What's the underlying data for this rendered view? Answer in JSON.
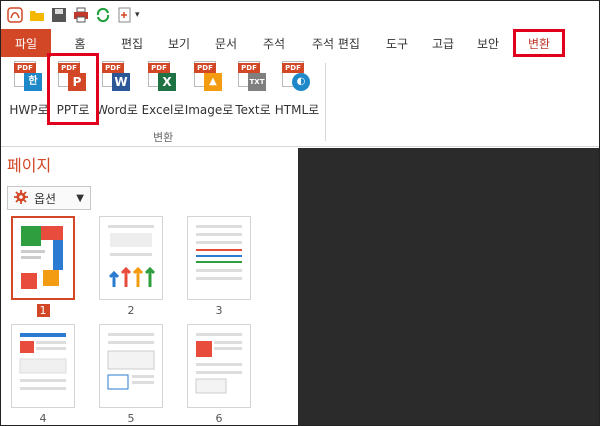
{
  "quick_access": {
    "icons": [
      "pdf-app-icon",
      "open-folder-icon",
      "save-icon",
      "print-icon",
      "refresh-icon",
      "add-page-icon"
    ],
    "dropdown": "▾"
  },
  "tabs": [
    {
      "label": "파일",
      "kind": "file"
    },
    {
      "label": "홈",
      "kind": "normal"
    },
    {
      "label": "편집",
      "kind": "normal"
    },
    {
      "label": "보기",
      "kind": "normal"
    },
    {
      "label": "문서",
      "kind": "normal"
    },
    {
      "label": "주석",
      "kind": "normal"
    },
    {
      "label": "주석 편집",
      "kind": "normal"
    },
    {
      "label": "도구",
      "kind": "normal"
    },
    {
      "label": "고급",
      "kind": "normal"
    },
    {
      "label": "보안",
      "kind": "normal"
    },
    {
      "label": "변환",
      "kind": "active"
    }
  ],
  "ribbon": {
    "group_label": "변환",
    "buttons": [
      {
        "label": "HWP로",
        "badge": "한",
        "color": "#1e88c8"
      },
      {
        "label": "PPT로",
        "badge": "P",
        "color": "#d24726"
      },
      {
        "label": "Word로",
        "badge": "W",
        "color": "#2b5797"
      },
      {
        "label": "Excel로",
        "badge": "X",
        "color": "#1f7244"
      },
      {
        "label": "Image로",
        "badge": "▲",
        "color": "#f39c12"
      },
      {
        "label": "Text로",
        "badge": "TXT",
        "color": "#7f7f7f"
      },
      {
        "label": "HTML로",
        "badge": "◐",
        "color": "#1e88c8"
      }
    ],
    "pdf_tag": "PDF"
  },
  "panel": {
    "title": "페이지",
    "options_label": "옵션",
    "pages": [
      "1",
      "2",
      "3",
      "4",
      "5",
      "6"
    ],
    "selected_page": "1"
  },
  "colors": {
    "accent": "#d24726",
    "highlight": "#e0001b",
    "canvas": "#2b2b2b"
  }
}
